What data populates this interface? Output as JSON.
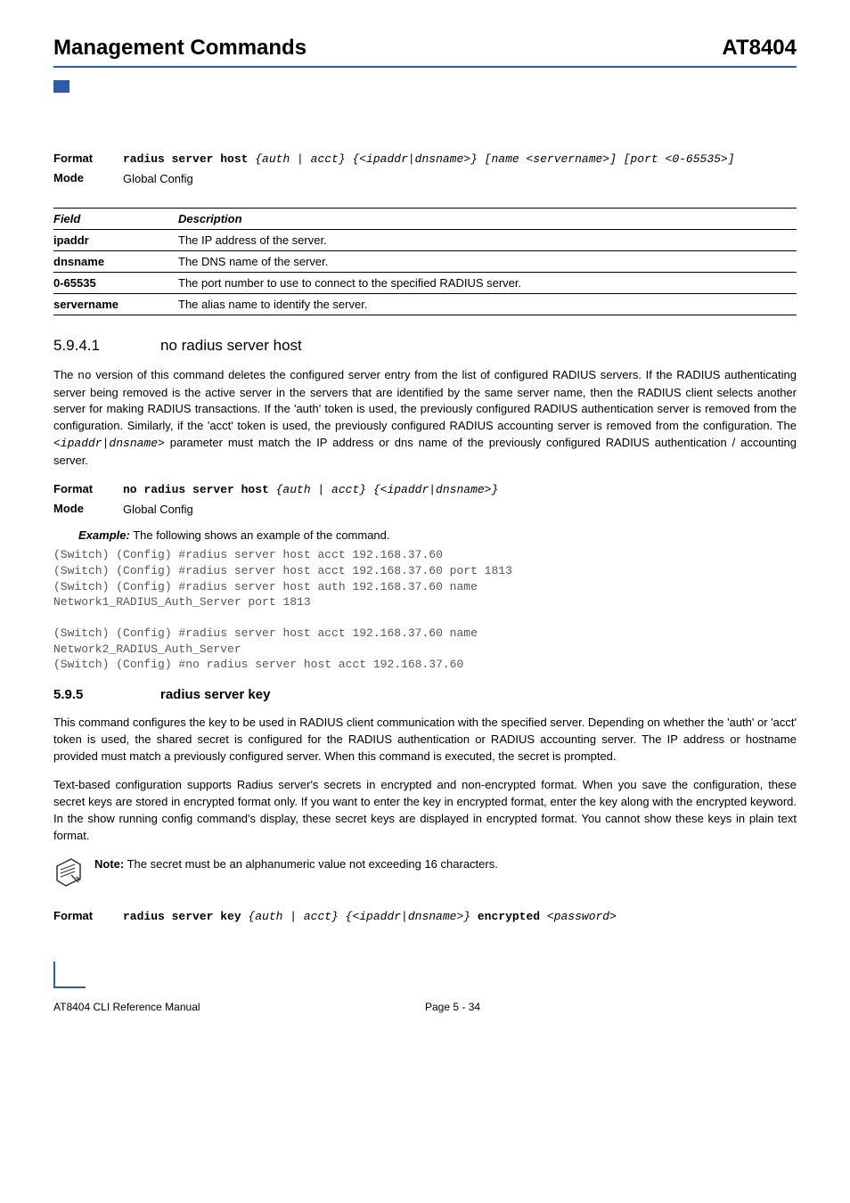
{
  "header": {
    "left": "Management Commands",
    "right": "AT8404"
  },
  "fmt1": {
    "label": "Format",
    "cmd": "radius server host",
    "args": " {auth | acct} {<ipaddr|dnsname>} [name <servername>] [port <0-65535>]"
  },
  "mode1": {
    "label": "Mode",
    "value": "Global Config"
  },
  "table": {
    "h1": "Field",
    "h2": "Description",
    "rows": [
      {
        "f": "ipaddr",
        "d": "The IP address of the server."
      },
      {
        "f": "dnsname",
        "d": "The DNS name of the server."
      },
      {
        "f": "0-65535",
        "d": "The port number to use to connect to the specified RADIUS server."
      },
      {
        "f": "servername",
        "d": "The alias name to identify the server."
      }
    ]
  },
  "s5941": {
    "num": "5.9.4.1",
    "title": "no radius server host",
    "p_a": "The ",
    "p_no": "no",
    "p_b": " version of this command deletes the configured server entry from the list of configured RADIUS servers. If the RADIUS authenticating server being removed is the active server in the servers that are identified by the same server name, then the RADIUS client selects another server for making RADIUS transactions. If the 'auth' token is used, the previously configured RADIUS authentication server is removed from the configuration. Similarly, if the 'acct' token is used, the previously configured RADIUS accounting server is removed from the configuration. The ",
    "p_param": "<ipaddr|dnsname>",
    "p_c": " parameter must match the IP address or dns name of the previously configured RADIUS authentication / accounting server."
  },
  "fmt2": {
    "label": "Format",
    "cmd": "no radius server host",
    "args": " {auth | acct} {<ipaddr|dnsname>}"
  },
  "mode2": {
    "label": "Mode",
    "value": "Global Config"
  },
  "example": {
    "label": "Example:",
    "text": " The following shows an example of the command.",
    "code": "(Switch) (Config) #radius server host acct 192.168.37.60\n(Switch) (Config) #radius server host acct 192.168.37.60 port 1813\n(Switch) (Config) #radius server host auth 192.168.37.60 name\nNetwork1_RADIUS_Auth_Server port 1813\n\n(Switch) (Config) #radius server host acct 192.168.37.60 name\nNetwork2_RADIUS_Auth_Server\n(Switch) (Config) #no radius server host acct 192.168.37.60"
  },
  "s595": {
    "num": "5.9.5",
    "title": "radius server key",
    "p1": "This command configures the key to be used in RADIUS client communication with the specified server. Depending on whether the 'auth' or 'acct' token is used, the shared secret is configured for the RADIUS authentication or RADIUS accounting server. The IP address or hostname provided must match a previously configured server. When this command is executed, the secret is prompted.",
    "p2": "Text-based configuration supports Radius server's secrets in encrypted and non-encrypted format. When you save the configuration, these secret keys are stored in encrypted format only. If you want to enter the key in encrypted format, enter the key along with the encrypted keyword. In the show running config command's display, these secret keys are displayed in encrypted format. You cannot show these keys in plain text format."
  },
  "note": {
    "label": "Note:",
    "text": " The secret must be an alphanumeric value not exceeding 16 characters."
  },
  "fmt3": {
    "label": "Format",
    "cmd": "radius server key",
    "args1": " {auth | acct} {<ipaddr|dnsname>} ",
    "enc": "encrypted",
    "args2": " <password>"
  },
  "footer": {
    "left": "AT8404 CLI Reference Manual",
    "center": "Page 5 - 34"
  }
}
